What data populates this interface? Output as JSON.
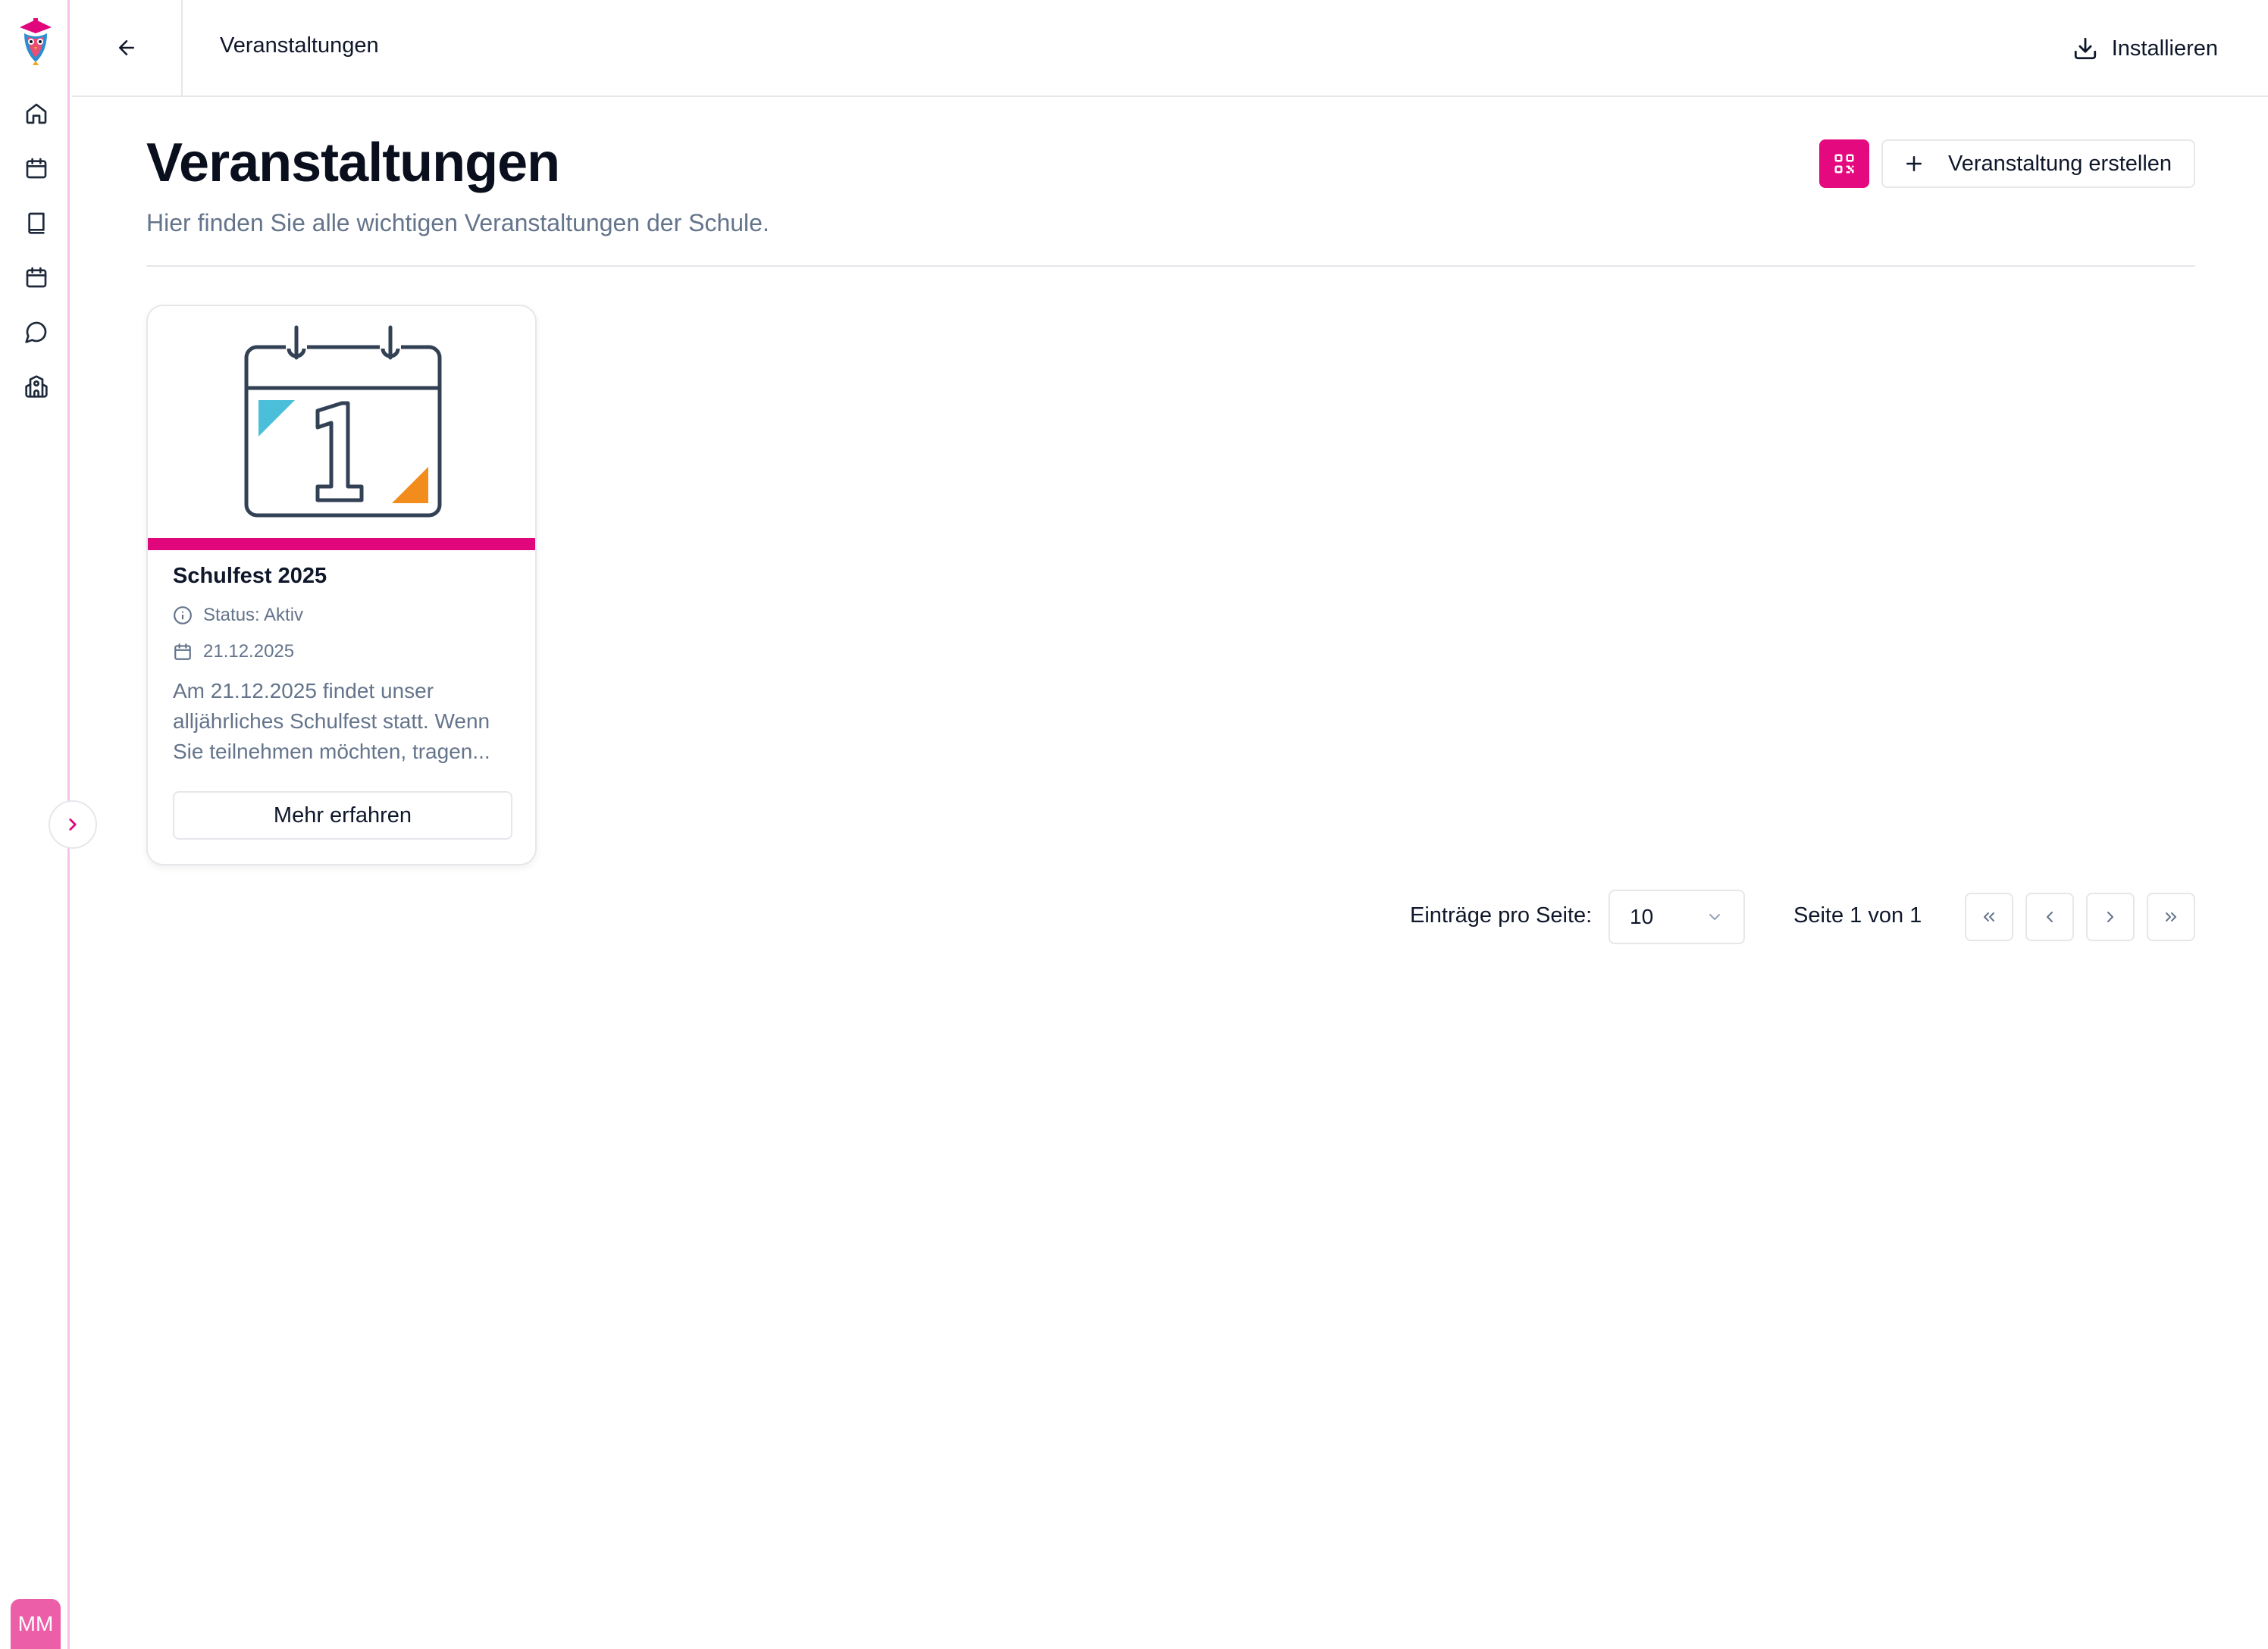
{
  "topbar": {
    "title": "Veranstaltungen",
    "install_label": "Installieren"
  },
  "page": {
    "title": "Veranstaltungen",
    "subtitle": "Hier finden Sie alle wichtigen Veranstaltungen der Schule.",
    "create_label": "Veranstaltung erstellen"
  },
  "sidebar": {
    "icons": [
      "home-icon",
      "calendar-icon",
      "book-icon",
      "calendar-icon",
      "chat-icon",
      "school-icon"
    ],
    "avatar_initials": "MM"
  },
  "events": [
    {
      "title": "Schulfest 2025",
      "status": "Status: Aktiv",
      "date": "21.12.2025",
      "description": "Am 21.12.2025 findet unser alljährliches Schulfest statt. Wenn Sie teilnehmen möchten, tragen...",
      "button_label": "Mehr erfahren",
      "image_day": "1"
    }
  ],
  "pagination": {
    "per_page_label": "Einträge pro Seite:",
    "per_page_value": "10",
    "page_indicator": "Seite 1 von 1"
  },
  "colors": {
    "accent": "#e0077d",
    "sidebar_border": "#f5c2e8",
    "avatar": "#ec5fa8",
    "calendar_blue": "#4bbfd9",
    "calendar_orange": "#f28c1c"
  }
}
